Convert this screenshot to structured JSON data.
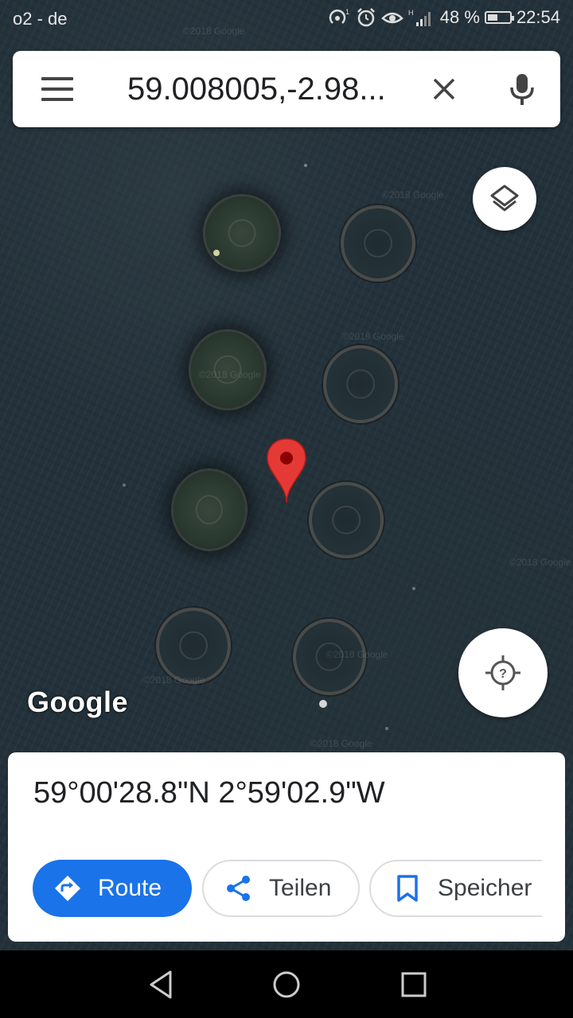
{
  "status_bar": {
    "carrier": "o2 - de",
    "battery_percent": "48 %",
    "battery_level": 0.48,
    "time": "22:54",
    "icons": [
      "hotspot-icon",
      "alarm-icon",
      "eye-comfort-icon",
      "signal-icon",
      "battery-charging-icon"
    ]
  },
  "search": {
    "query": "59.008005,-2.98...",
    "menu_icon": "menu-icon",
    "clear_icon": "close-icon",
    "mic_icon": "mic-icon"
  },
  "map": {
    "mode": "satellite",
    "logo": "Google",
    "watermark": "©2018 Google",
    "layers_icon": "layers-icon",
    "locate_icon": "location-unknown-icon",
    "marker_icon": "map-pin-icon",
    "colors": {
      "pin": "#e53935",
      "water": "#23313a"
    }
  },
  "place_sheet": {
    "coordinates": "59°00'28.8\"N 2°59'02.9\"W",
    "actions": [
      {
        "label": "Route",
        "icon": "directions-icon"
      },
      {
        "label": "Teilen",
        "icon": "share-icon"
      },
      {
        "label": "Speicher",
        "icon": "bookmark-icon"
      }
    ],
    "accent": "#1a73e8"
  },
  "nav_bar": {
    "icons": [
      "back-icon",
      "home-icon",
      "recent-apps-icon"
    ]
  }
}
